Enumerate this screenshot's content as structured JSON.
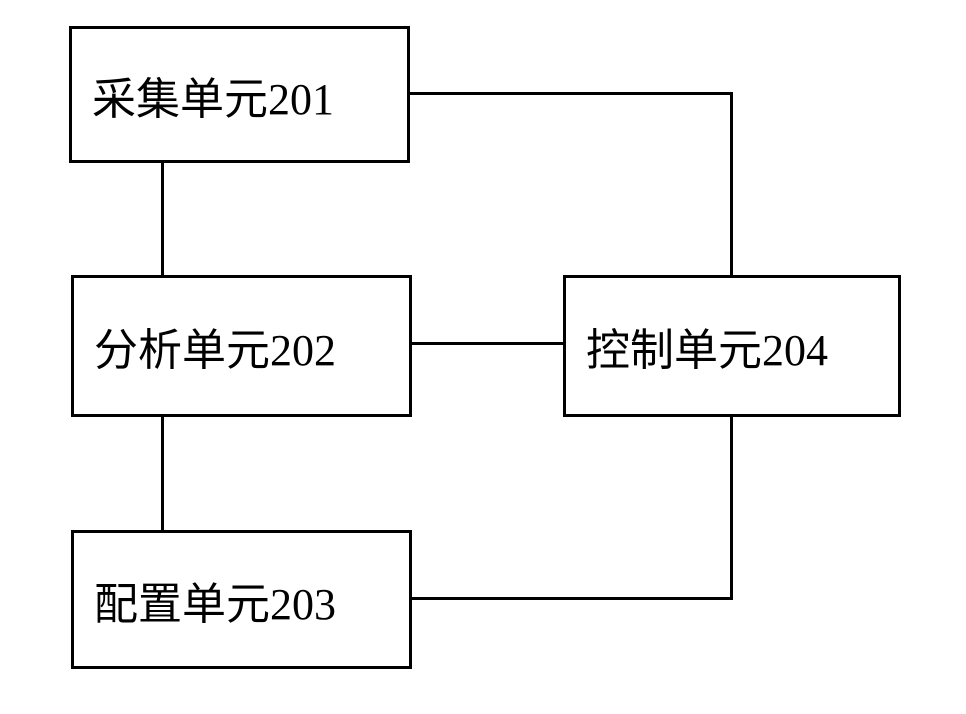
{
  "boxes": {
    "collection": "采集单元201",
    "analysis": "分析单元202",
    "configuration": "配置单元203",
    "control": "控制单元204"
  }
}
